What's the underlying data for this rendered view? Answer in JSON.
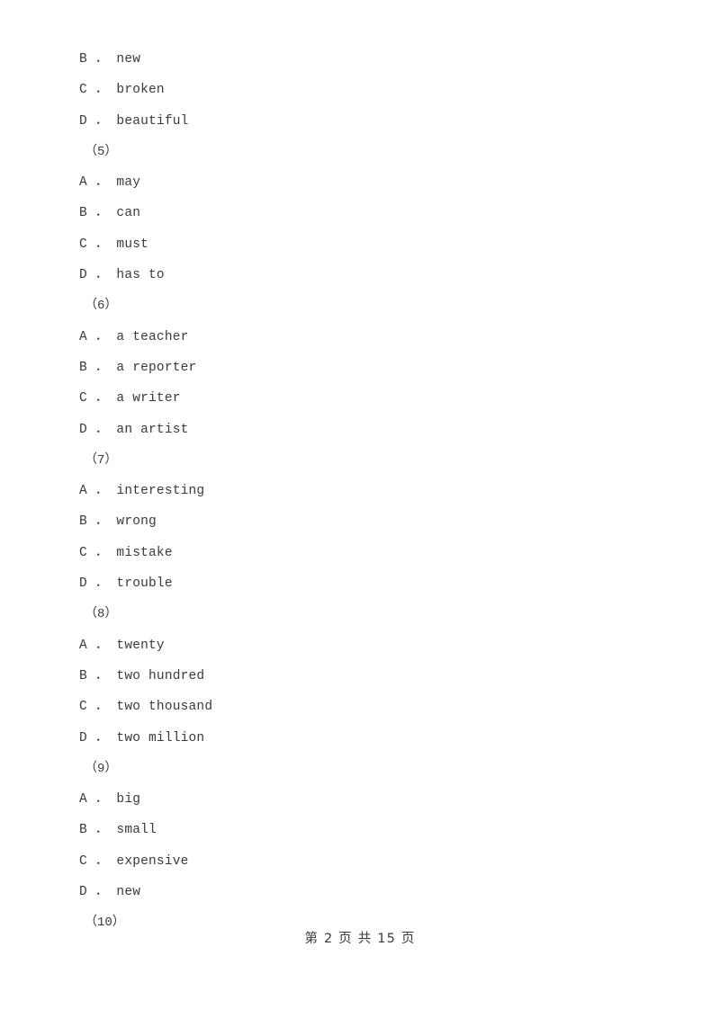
{
  "document": {
    "background_color": "#ffffff",
    "text_color": "#3a3a3a"
  },
  "body_lines": [
    {
      "kind": "option",
      "letter": "B",
      "separator": " ． ",
      "text": "new"
    },
    {
      "kind": "option",
      "letter": "C",
      "separator": " ． ",
      "text": "broken"
    },
    {
      "kind": "option",
      "letter": "D",
      "separator": " ． ",
      "text": "beautiful"
    },
    {
      "kind": "question",
      "label": "（5）"
    },
    {
      "kind": "option",
      "letter": "A",
      "separator": " ． ",
      "text": "may"
    },
    {
      "kind": "option",
      "letter": "B",
      "separator": " ． ",
      "text": "can"
    },
    {
      "kind": "option",
      "letter": "C",
      "separator": " ． ",
      "text": "must"
    },
    {
      "kind": "option",
      "letter": "D",
      "separator": " ． ",
      "text": "has to"
    },
    {
      "kind": "question",
      "label": "（6）"
    },
    {
      "kind": "option",
      "letter": "A",
      "separator": " ． ",
      "text": "a teacher"
    },
    {
      "kind": "option",
      "letter": "B",
      "separator": " ． ",
      "text": "a reporter"
    },
    {
      "kind": "option",
      "letter": "C",
      "separator": " ． ",
      "text": "a writer"
    },
    {
      "kind": "option",
      "letter": "D",
      "separator": " ． ",
      "text": "an artist"
    },
    {
      "kind": "question",
      "label": "（7）"
    },
    {
      "kind": "option",
      "letter": "A",
      "separator": " ． ",
      "text": "interesting"
    },
    {
      "kind": "option",
      "letter": "B",
      "separator": " ． ",
      "text": "wrong"
    },
    {
      "kind": "option",
      "letter": "C",
      "separator": " ． ",
      "text": "mistake"
    },
    {
      "kind": "option",
      "letter": "D",
      "separator": " ． ",
      "text": "trouble"
    },
    {
      "kind": "question",
      "label": "（8）"
    },
    {
      "kind": "option",
      "letter": "A",
      "separator": " ． ",
      "text": "twenty"
    },
    {
      "kind": "option",
      "letter": "B",
      "separator": " ． ",
      "text": "two hundred"
    },
    {
      "kind": "option",
      "letter": "C",
      "separator": " ． ",
      "text": "two thousand"
    },
    {
      "kind": "option",
      "letter": "D",
      "separator": " ． ",
      "text": "two million"
    },
    {
      "kind": "question",
      "label": "（9）"
    },
    {
      "kind": "option",
      "letter": "A",
      "separator": " ． ",
      "text": "big"
    },
    {
      "kind": "option",
      "letter": "B",
      "separator": " ． ",
      "text": "small"
    },
    {
      "kind": "option",
      "letter": "C",
      "separator": " ． ",
      "text": "expensive"
    },
    {
      "kind": "option",
      "letter": "D",
      "separator": " ． ",
      "text": "new"
    },
    {
      "kind": "question",
      "label": "（10）"
    }
  ],
  "footer": {
    "text": "第 2 页 共 15 页",
    "current_page": 2,
    "total_pages": 15
  }
}
